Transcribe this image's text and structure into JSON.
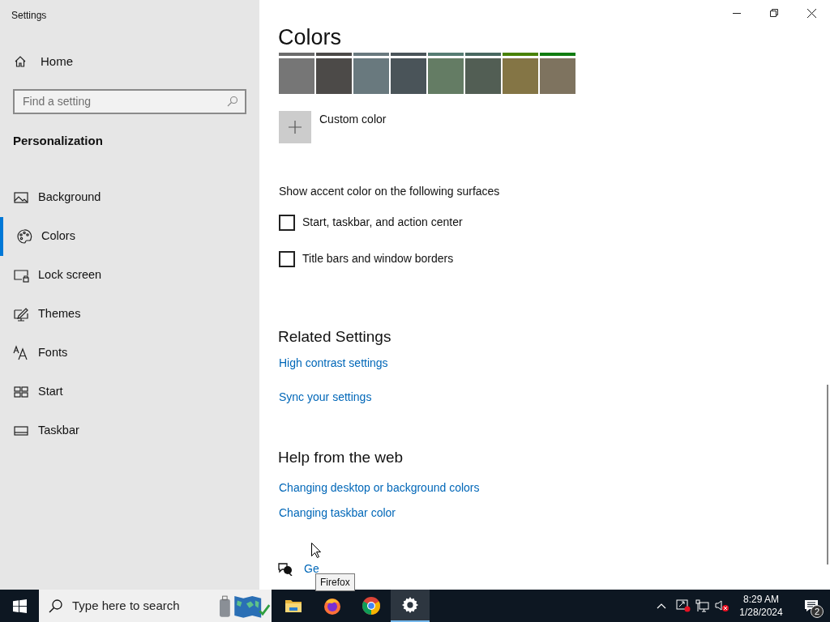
{
  "window": {
    "title": "Settings"
  },
  "sidebar": {
    "home": "Home",
    "search": {
      "placeholder": "Find a setting"
    },
    "section": "Personalization",
    "items": [
      {
        "label": "Background",
        "selected": false
      },
      {
        "label": "Colors",
        "selected": true
      },
      {
        "label": "Lock screen",
        "selected": false
      },
      {
        "label": "Themes",
        "selected": false
      },
      {
        "label": "Fonts",
        "selected": false
      },
      {
        "label": "Start",
        "selected": false
      },
      {
        "label": "Taskbar",
        "selected": false
      }
    ]
  },
  "main": {
    "title": "Colors",
    "swatches_above": [
      {
        "color": "#6b6b6b"
      },
      {
        "color": "#4c4a48"
      },
      {
        "color": "#69797e"
      },
      {
        "color": "#4a5459"
      },
      {
        "color": "#567c73"
      },
      {
        "color": "#486860"
      },
      {
        "color": "#498205"
      },
      {
        "color": "#107c10"
      }
    ],
    "swatches": [
      {
        "color": "#767676"
      },
      {
        "color": "#4c4a48"
      },
      {
        "color": "#69797e"
      },
      {
        "color": "#4a5459"
      },
      {
        "color": "#647c64"
      },
      {
        "color": "#525e54"
      },
      {
        "color": "#847545"
      },
      {
        "color": "#7e735f"
      }
    ],
    "custom_color": "Custom color",
    "surfaces_heading": "Show accent color on the following surfaces",
    "checkboxes": [
      {
        "label": "Start, taskbar, and action center",
        "checked": false
      },
      {
        "label": "Title bars and window borders",
        "checked": false
      }
    ],
    "related": {
      "heading": "Related Settings",
      "links": [
        "High contrast settings",
        "Sync your settings"
      ]
    },
    "help": {
      "heading": "Help from the web",
      "links": [
        "Changing desktop or background colors",
        "Changing taskbar color"
      ]
    },
    "get_help": "Ge",
    "tooltip": "Firefox"
  },
  "taskbar": {
    "search": {
      "placeholder": "Type here to search"
    },
    "apps": [
      {
        "kind": "explorer",
        "active": false
      },
      {
        "kind": "firefox",
        "active": false
      },
      {
        "kind": "chrome",
        "active": false
      },
      {
        "kind": "settings",
        "active": true
      }
    ],
    "time": "8:29 AM",
    "date": "1/28/2024",
    "notifications": "2"
  }
}
